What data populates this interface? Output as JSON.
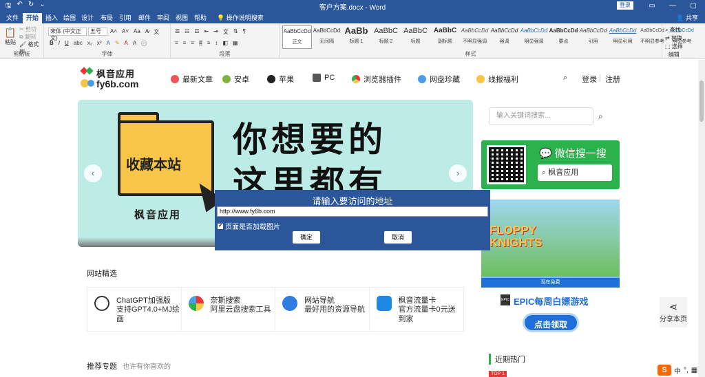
{
  "titlebar": {
    "doc_title": "客户方案.docx - Word",
    "login": "登录"
  },
  "menu": {
    "tabs": [
      "文件",
      "开始",
      "插入",
      "绘图",
      "设计",
      "布局",
      "引用",
      "邮件",
      "审阅",
      "视图",
      "帮助"
    ],
    "search": "操作说明搜索",
    "share": "共享"
  },
  "ribbon": {
    "clipboard": {
      "paste": "粘贴",
      "cut": "剪切",
      "copy": "复制",
      "format_painter": "格式刷",
      "label": "剪贴板"
    },
    "font": {
      "name": "宋体 (中文正文)",
      "size": "五号",
      "label": "字体"
    },
    "paragraph_label": "段落",
    "styles_label": "样式",
    "styles": [
      {
        "preview": "AaBbCcDd",
        "name": "正文"
      },
      {
        "preview": "AaBbCcDd",
        "name": "无间隔"
      },
      {
        "preview": "AaBb",
        "name": "标题 1"
      },
      {
        "preview": "AaBbC",
        "name": "标题 2"
      },
      {
        "preview": "AaBbC",
        "name": "标题"
      },
      {
        "preview": "AaBbC",
        "name": "副标题"
      },
      {
        "preview": "AaBbCcDd",
        "name": "不明显强调"
      },
      {
        "preview": "AaBbCcDd",
        "name": "强调"
      },
      {
        "preview": "AaBbCcDd",
        "name": "明显强调"
      },
      {
        "preview": "AaBbCcDd",
        "name": "要点"
      },
      {
        "preview": "AaBbCcDd",
        "name": "引用"
      },
      {
        "preview": "AaBbCcDd",
        "name": "明显引用"
      },
      {
        "preview": "AaBbCcDd",
        "name": "不明显参考"
      },
      {
        "preview": "AaBbCcDd",
        "name": "明显参考"
      }
    ],
    "editing": {
      "find": "查找",
      "replace": "替换",
      "select": "选择",
      "label": "编辑"
    }
  },
  "site": {
    "logo_line1": "枫音应用",
    "logo_line2": "fy6b.com",
    "nav": [
      "最新文章",
      "安卓",
      "苹果",
      "PC",
      "浏览器插件",
      "网盘珍藏",
      "线报福利"
    ],
    "login": "登录",
    "register": "注册",
    "banner": {
      "folder": "收藏本站",
      "line1": "你想要的",
      "line2": "这里都有",
      "brand": "枫音应用"
    },
    "search_placeholder": "输入关键词搜索...",
    "wechat": {
      "title": "微信搜一搜",
      "input": "枫音应用"
    },
    "ad": {
      "game": "FLOPPY KNIGHTS",
      "free": "现在免费",
      "epic": "EPIC每周白嫖游戏",
      "button": "点击领取"
    },
    "featured_title": "网站精选",
    "cards": [
      {
        "title": "ChatGPT加强版",
        "desc": "支持GPT4.0+MJ绘画"
      },
      {
        "title": "奈斯搜索",
        "desc": "阿里云盘搜索工具"
      },
      {
        "title": "网站导航",
        "desc": "最好用的资源导航"
      },
      {
        "title": "枫音流量卡",
        "desc": "官方流量卡0元送到家"
      }
    ],
    "recommend": "推荐专题",
    "recommend_sub": "也许有你喜欢的",
    "hot": "近期热门",
    "top1": "TOP 1",
    "share": "分享本页"
  },
  "dialog": {
    "title": "请输入要访问的地址",
    "url": "http://www.fy6b.com",
    "checkbox": "页面是否加载图片",
    "ok": "确定",
    "cancel": "取消"
  },
  "ime": {
    "lang": "中"
  }
}
